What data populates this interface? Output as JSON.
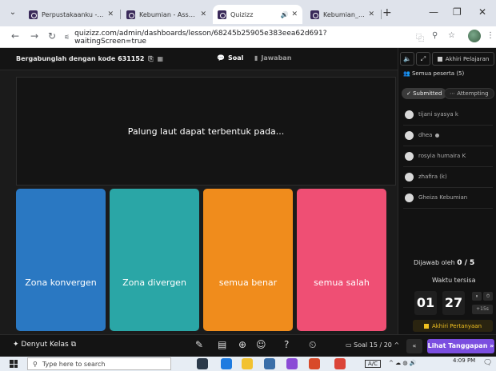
{
  "browser": {
    "tabs": [
      {
        "title": "Perpustakaanku - Quizizz",
        "active": false
      },
      {
        "title": "Kebumian - Assessment",
        "active": false
      },
      {
        "title": "Quizizz",
        "active": true
      },
      {
        "title": "Kebumian_mineral dan",
        "active": false
      }
    ],
    "url": "quizizz.com/admin/dashboards/lesson/68245b25905e383eea62d691?waitingScreen=true"
  },
  "header": {
    "join_prefix": "Bergabunglah dengan kode",
    "join_code": "631152",
    "tab_soal": "Soal",
    "tab_jawaban": "Jawaban"
  },
  "question": {
    "text": "Palung laut dapat terbentuk pada...",
    "options": [
      {
        "label": "Zona konvergen",
        "color": "#2a78c2"
      },
      {
        "label": "Zona divergen",
        "color": "#2aa6a6"
      },
      {
        "label": "semua benar",
        "color": "#f08c1c"
      },
      {
        "label": "semua salah",
        "color": "#ef4f74"
      }
    ]
  },
  "panel": {
    "end_lesson": "Akhiri Pelajaran",
    "all_participants": "Semua peserta (5)",
    "filter_submitted": "Submitted",
    "filter_attempting": "Attempting",
    "participants": [
      "tijani syasya k",
      "dhea",
      "rosyia humaira K",
      "zhafira (k)",
      "Gheiza Kebumian"
    ],
    "answered_label": "Dijawab oleh",
    "answered_value": "0 / 5",
    "time_label": "Waktu tersisa",
    "time_minutes": "01",
    "time_seconds": "27",
    "add_time": "+15s",
    "end_question": "Akhiri Pertanyaan"
  },
  "bottom": {
    "pulse": "Denyut Kelas",
    "question_counter": "Soal 15 / 20",
    "next_answers": "Lihat Tanggapan"
  },
  "taskbar": {
    "search_placeholder": "Type here to search",
    "clock": "4:09 PM",
    "lang": "A/C"
  },
  "colors": {
    "accent_purple": "#7b4ee0",
    "end_question_yellow": "#f0c020"
  }
}
